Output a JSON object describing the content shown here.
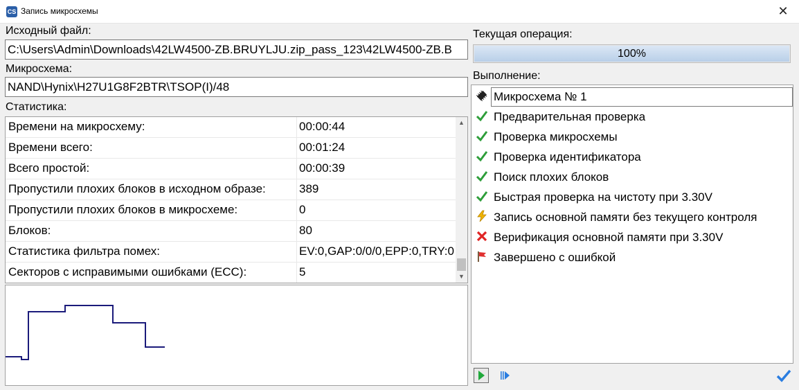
{
  "window": {
    "title": "Запись микросхемы",
    "icon_text": "CS",
    "close_glyph": "✕"
  },
  "source": {
    "label": "Исходный файл:",
    "value": "C:\\Users\\Admin\\Downloads\\42LW4500-ZB.BRUYLJU.zip_pass_123\\42LW4500-ZB.B"
  },
  "chip": {
    "label": "Микросхема:",
    "value": "NAND\\Hynix\\H27U1G8F2BTR\\TSOP(I)/48"
  },
  "stats": {
    "label": "Статистика:",
    "rows": [
      {
        "name": "Времени на микросхему:",
        "value": "00:00:44"
      },
      {
        "name": "Времени всего:",
        "value": "00:01:24"
      },
      {
        "name": "Всего простой:",
        "value": "00:00:39"
      },
      {
        "name": "Пропустили плохих блоков в исходном образе:",
        "value": "389"
      },
      {
        "name": "Пропустили плохих блоков в микросхеме:",
        "value": "0"
      },
      {
        "name": "Блоков:",
        "value": "80"
      },
      {
        "name": "Статистика фильтра помех:",
        "value": "EV:0,GAP:0/0/0,EPP:0,TRY:0"
      },
      {
        "name": "Секторов с исправимыми ошибками (ECC):",
        "value": "5"
      }
    ],
    "scroll_up_glyph": "▲",
    "scroll_down_glyph": "▼"
  },
  "operation": {
    "label": "Текущая операция:",
    "progress_text": "100%",
    "progress_value": 100
  },
  "execution": {
    "label": "Выполнение:",
    "items": [
      {
        "icon": "chip-icon",
        "text": "Микросхема № 1"
      },
      {
        "icon": "checkmark-icon",
        "text": "Предварительная проверка"
      },
      {
        "icon": "checkmark-icon",
        "text": "Проверка микросхемы"
      },
      {
        "icon": "checkmark-icon",
        "text": "Проверка идентификатора"
      },
      {
        "icon": "checkmark-icon",
        "text": "Поиск плохих блоков"
      },
      {
        "icon": "checkmark-icon",
        "text": "Быстрая проверка на чистоту при  3.30V"
      },
      {
        "icon": "lightning-icon",
        "text": "Запись основной памяти без текущего контроля"
      },
      {
        "icon": "red-cross-icon",
        "text": "Верификация основной памяти при  3.30V"
      },
      {
        "icon": "flag-icon",
        "text": "Завершено с ошибкой"
      }
    ]
  },
  "colors": {
    "check": "#2e9e3a",
    "cross": "#e02424",
    "graph_line": "#1a1a7a",
    "lightning": "#f0b400"
  }
}
